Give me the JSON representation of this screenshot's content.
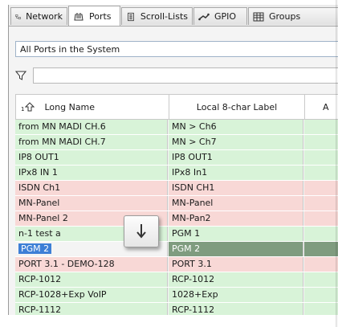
{
  "tabs": [
    {
      "label": "Network",
      "icon": "network-icon",
      "active": false
    },
    {
      "label": "Ports",
      "icon": "ports-icon",
      "active": true
    },
    {
      "label": "Scroll-Lists",
      "icon": "scroll-list-icon",
      "active": false
    },
    {
      "label": "GPIO",
      "icon": "gpio-icon",
      "active": false
    },
    {
      "label": "Groups",
      "icon": "groups-icon",
      "active": false
    }
  ],
  "scope_select": {
    "value": "All Ports in the System"
  },
  "filter": {
    "value": ""
  },
  "table": {
    "sort_index": "1",
    "columns": [
      "Long Name",
      "Local 8-char Label",
      "A"
    ],
    "rows": [
      {
        "long_name": "from MN MADI CH.6",
        "label": "MN > Ch6",
        "color": "green"
      },
      {
        "long_name": "from MN MADI CH.7",
        "label": "MN > Ch7",
        "color": "green"
      },
      {
        "long_name": "IP8 OUT1",
        "label": "IP8 OUT1",
        "color": "green"
      },
      {
        "long_name": "IPx8 IN 1",
        "label": "IPx8 In1",
        "color": "green"
      },
      {
        "long_name": "ISDN Ch1",
        "label": "ISDN CH1",
        "color": "pink"
      },
      {
        "long_name": "MN-Panel",
        "label": "MN-Panel",
        "color": "pink"
      },
      {
        "long_name": "MN-Panel 2",
        "label": "MN-Pan2",
        "color": "pink"
      },
      {
        "long_name": "n-1 test a",
        "label": "PGM 1",
        "color": "green"
      },
      {
        "long_name": "PGM 2",
        "label": "PGM 2",
        "color": "selected"
      },
      {
        "long_name": "PORT 3.1 - DEMO-128",
        "label": "PORT 3.1",
        "color": "pink"
      },
      {
        "long_name": "RCP-1012",
        "label": "RCP-1012",
        "color": "green"
      },
      {
        "long_name": "RCP-1028+Exp VoIP",
        "label": "1028+Exp",
        "color": "green"
      },
      {
        "long_name": "RCP-1112",
        "label": "RCP-1112",
        "color": "green"
      }
    ]
  },
  "drag_indicator": {
    "glyph": "↓",
    "icon": "arrow-down-icon"
  },
  "colors": {
    "green_row": "#d8f3d8",
    "pink_row": "#f8d8d6",
    "selection": "#3d7fd6",
    "selected_row": "#7f9c7f"
  }
}
